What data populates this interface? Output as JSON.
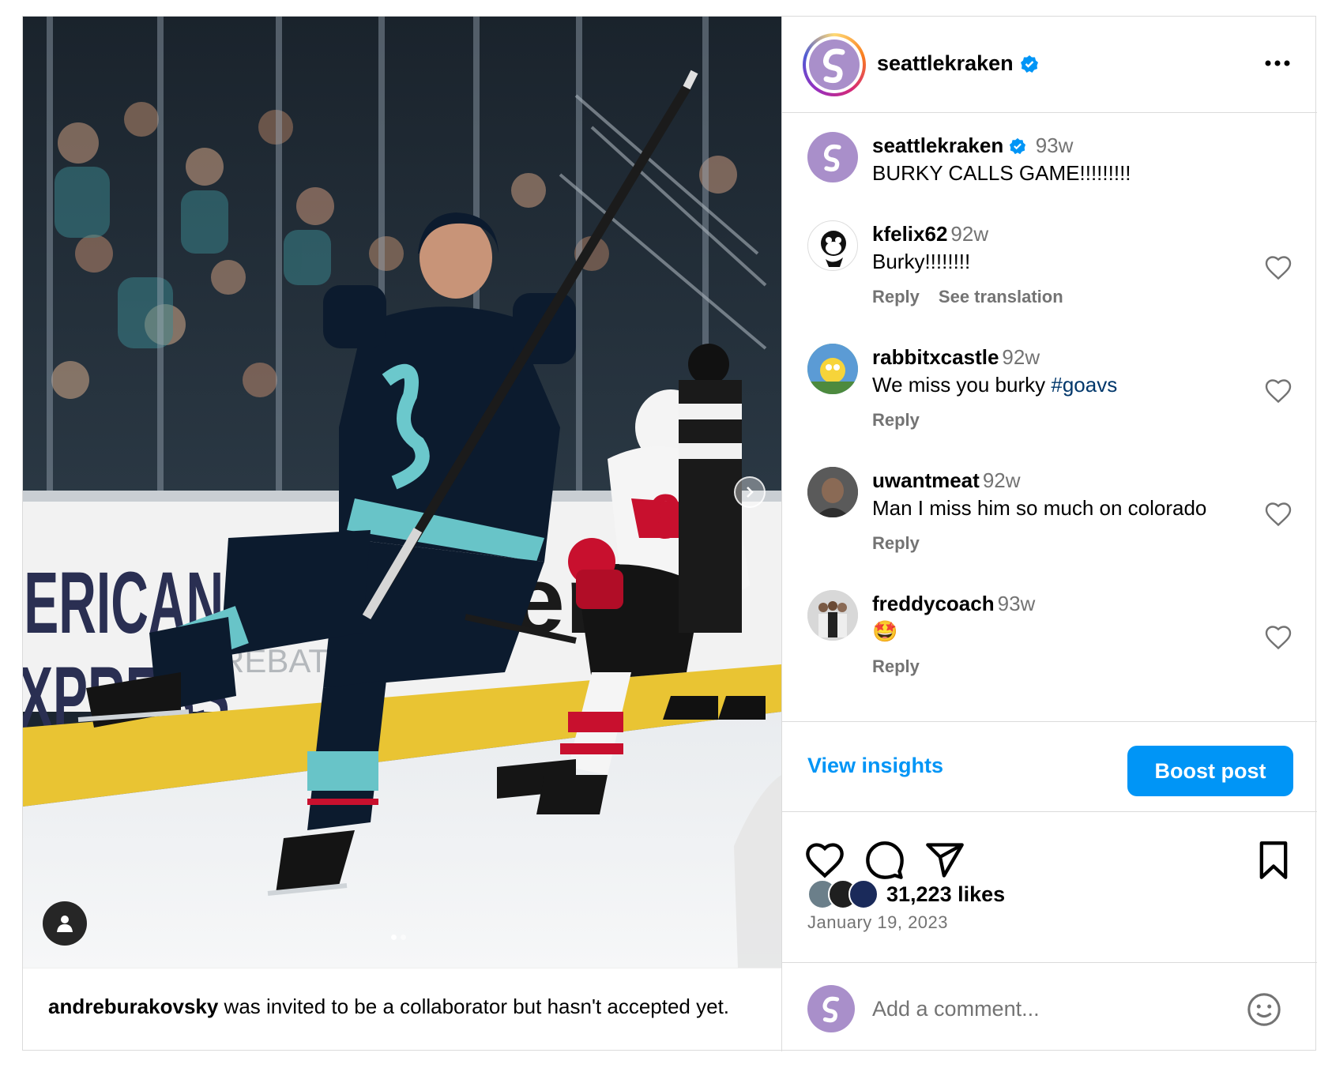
{
  "post": {
    "account": "seattlekraken",
    "verified_icon": "verified-badge-icon",
    "more_icon": "more-options-icon",
    "caption_time": "93w",
    "caption_text": "BURKY CALLS GAME!!!!!!!!!",
    "collab_user": "andreburakovsky",
    "collab_text": " was invited to be a collaborator but hasn't accepted yet.",
    "media_icons": [
      "user-tag-icon",
      "next-slide-icon"
    ]
  },
  "comments": [
    {
      "user": "kfelix62",
      "time": "92w",
      "text": "Burky!!!!!!!!",
      "reply": "Reply",
      "translate": "See translation"
    },
    {
      "user": "rabbitxcastle",
      "time": "92w",
      "text": "We miss you burky ",
      "hashtag": "#goavs",
      "reply": "Reply"
    },
    {
      "user": "uwantmeat",
      "time": "92w",
      "text": "Man I miss him so much on colorado",
      "reply": "Reply"
    },
    {
      "user": "freddycoach",
      "time": "93w",
      "text": "🤩",
      "reply": "Reply"
    }
  ],
  "insights": {
    "view_label": "View insights",
    "boost_label": "Boost post"
  },
  "actions": {
    "icons": [
      "heart-icon",
      "comment-icon",
      "share-icon",
      "bookmark-icon"
    ]
  },
  "likes": {
    "count_text": "31,223 likes",
    "date": "January 19, 2023"
  },
  "add_comment": {
    "placeholder": "Add a comment...",
    "emoji_icon": "emoji-icon"
  },
  "colors": {
    "accent": "#0095f6",
    "kraken_purple": "#a98fca",
    "secondary_text": "#737373",
    "hashtag": "#00376b"
  }
}
